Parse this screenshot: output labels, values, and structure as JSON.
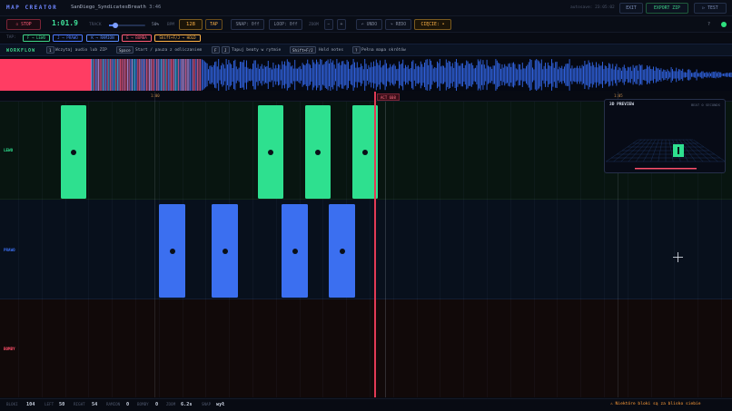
{
  "header": {
    "logo": "MAP CREATOR",
    "song_name": "SanDiego_SyndicatesBreath",
    "song_duration": "3:46",
    "autosave": "autosave: 23:05:02",
    "buttons": [
      {
        "id": "exit",
        "label": "EXIT"
      },
      {
        "id": "export",
        "label": "EXPORT ZIP"
      },
      {
        "id": "test",
        "label": "▷ TEST"
      }
    ]
  },
  "toolbar": {
    "stop_label": "▫ STOP",
    "time": "1:01.9",
    "track_label": "TRACK",
    "track_volume_pct": 50,
    "track_volume_text": "50%",
    "bpm_label": "BPM",
    "bpm_value": "128",
    "tap_label": "TAP",
    "snap_label": "SNAP: 0ff",
    "loop_label": "LOOP: 0ff",
    "zoom_label": "ZOOM",
    "zoom_minus": "−",
    "zoom_plus": "+",
    "undo_label": "↶ UNDO",
    "redo_label": "↷ REDO",
    "cut_label": "CIĘCIE: •",
    "help_label": "?"
  },
  "legend": {
    "tap_label": "TAP:",
    "items": [
      {
        "label": "F → LEWO",
        "color": "#3fd58a"
      },
      {
        "label": "J → PRAWO",
        "color": "#4d79ff"
      },
      {
        "label": "K → RAMION",
        "color": "#5a8cff"
      },
      {
        "label": "E → BOMBA",
        "color": "#ff5c78"
      },
      {
        "label": "Shift+F/J → HOLD",
        "color": "#ffb347"
      }
    ]
  },
  "workflow": {
    "title": "WORKFLOW",
    "steps": [
      {
        "key": "1",
        "text": "Wczytaj audio lub ZIP"
      },
      {
        "key": "Space",
        "text": "Start / pauza z odliczaniem"
      },
      {
        "key": "F",
        "key2": "J",
        "text": "Tapuj beaty w rytmie"
      },
      {
        "key": "Shift+F/J",
        "text": "Hold notes"
      },
      {
        "key": "?",
        "text": "Pełna mapa skrótów"
      }
    ]
  },
  "ruler": {
    "marks": [
      {
        "label": "1:00"
      },
      {
        "label": "1:05"
      }
    ],
    "playhead_tag": "ACT 608"
  },
  "lanes": [
    {
      "label": "LEWO",
      "color": "#2ee08f"
    },
    {
      "label": "PRAWO",
      "color": "#3b6ff0"
    },
    {
      "label": "BOMBY",
      "color": "#ff4f6a"
    }
  ],
  "preview": {
    "title": "3D PREVIEW",
    "info": "BEAT 0 SECONDS"
  },
  "status": {
    "items": [
      {
        "label": "BLOKI",
        "value": "104"
      },
      {
        "label": "LEFT",
        "value": "50"
      },
      {
        "label": "RIGHT",
        "value": "54"
      },
      {
        "label": "RAMION",
        "value": "0"
      },
      {
        "label": "BOMBY",
        "value": "0"
      },
      {
        "label": "ZOOM",
        "value": "6.2s"
      },
      {
        "label": "SNAP",
        "value": "wył"
      }
    ],
    "warning": "⚠ Niektóre bloki są za blisko siebie"
  },
  "colors": {
    "accent_green": "#3fd58a",
    "accent_blue": "#4d79ff",
    "accent_orange": "#ffb347",
    "accent_red": "#ff5c78"
  }
}
